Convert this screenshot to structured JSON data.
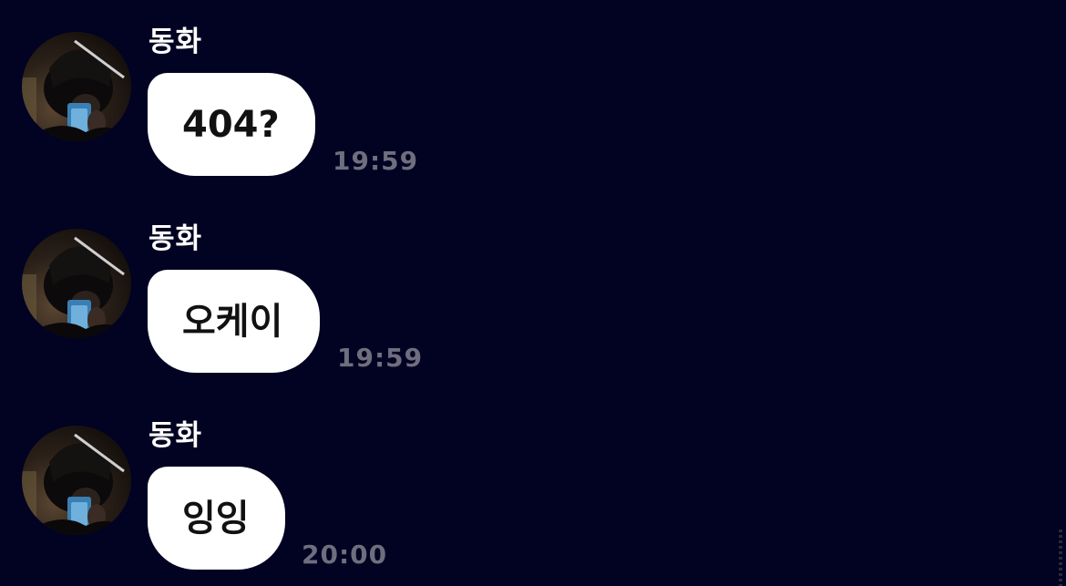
{
  "colors": {
    "background": "#020222",
    "bubble": "#ffffff",
    "bubble_text": "#111111",
    "sender_name": "#ffffff",
    "timestamp": "#6e6e7e"
  },
  "messages": [
    {
      "sender": "동화",
      "avatar_icon": "profile-photo",
      "text": "404?",
      "time": "19:59"
    },
    {
      "sender": "동화",
      "avatar_icon": "profile-photo",
      "text": "오케이",
      "time": "19:59"
    },
    {
      "sender": "동화",
      "avatar_icon": "profile-photo",
      "text": "잉잉",
      "time": "20:00"
    }
  ]
}
